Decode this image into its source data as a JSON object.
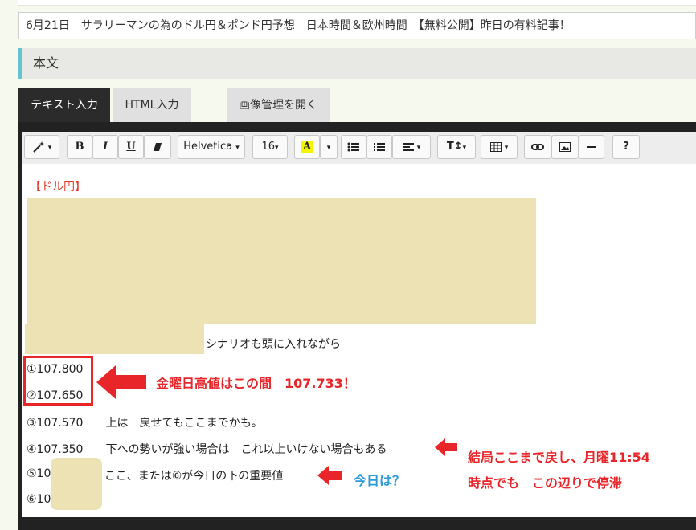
{
  "post_title": "6月21日　サラリーマンの為のドル円＆ポンド円予想　日本時間＆欧州時間　【無料公開】昨日の有料記事！",
  "section_label": "本文",
  "tabs": {
    "text": "テキスト入力",
    "html": "HTML入力",
    "images": "画像管理を開く"
  },
  "toolbar": {
    "bold": "B",
    "italic": "I",
    "underline": "U",
    "font_family": "Helvetica",
    "font_size": "16",
    "text_color": "A",
    "font_size_menu": "T↕",
    "help": "?"
  },
  "content": {
    "heading": "【ドル円】",
    "scenario_line": "シナリオも頭に入れながら",
    "lines": [
      "①107.800",
      "②107.650",
      "③107.570　　上は　戻せてもここまでかも。",
      "④107.350　　下への勢いが強い場合は　これ以上いけない場合もある",
      "⑤10",
      "⑥10"
    ],
    "line5_rest": "ここ、または⑥が今日の下の重要値"
  },
  "annotations": {
    "friday_high": "金曜日高値はこの間　107.733！",
    "monday_1": "結局ここまで戻し、月曜11:54",
    "monday_2": "時点でも　この辺りで停滞",
    "today": "今日は？"
  },
  "colors": {
    "annotation_red": "#e8262a",
    "annotation_blue": "#2c9bd6",
    "heading_red": "#e03a2a",
    "redaction": "#ece2b3",
    "accent_bar": "#64c4cf"
  }
}
